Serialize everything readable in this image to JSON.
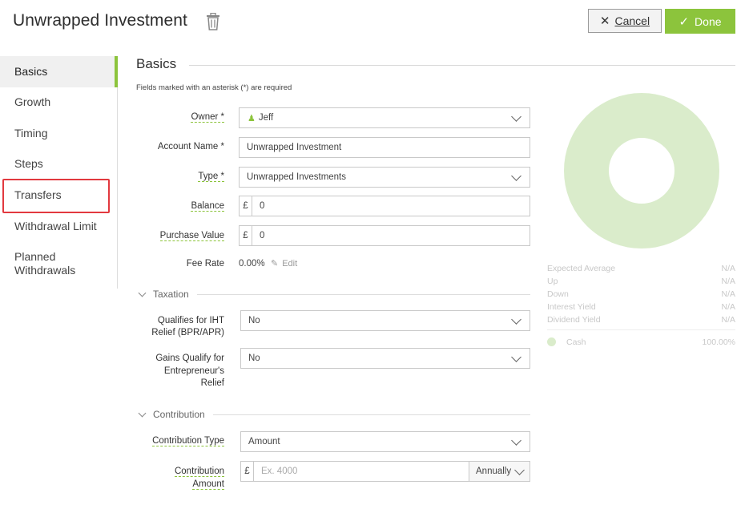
{
  "header": {
    "title": "Unwrapped Investment",
    "cancel_label": "Cancel",
    "done_label": "Done"
  },
  "sidebar": {
    "items": [
      {
        "label": "Basics"
      },
      {
        "label": "Growth"
      },
      {
        "label": "Timing"
      },
      {
        "label": "Steps"
      },
      {
        "label": "Transfers"
      },
      {
        "label": "Withdrawal Limit"
      },
      {
        "label": "Planned Withdrawals"
      }
    ]
  },
  "basics": {
    "title": "Basics",
    "required_note": "Fields marked with an asterisk (*) are required",
    "owner_label": "Owner *",
    "owner_value": "Jeff",
    "account_name_label": "Account Name *",
    "account_name_value": "Unwrapped Investment",
    "type_label": "Type *",
    "type_value": "Unwrapped Investments",
    "balance_label": "Balance",
    "balance_prefix": "£",
    "balance_value": "0",
    "purchase_label": "Purchase Value",
    "purchase_prefix": "£",
    "purchase_value": "0",
    "fee_rate_label": "Fee Rate",
    "fee_rate_value": "0.00%",
    "edit_label": "Edit"
  },
  "taxation": {
    "title": "Taxation",
    "iht_label_1": "Qualifies for IHT",
    "iht_label_2": "Relief (BPR/APR)",
    "iht_value": "No",
    "gains_label_1": "Gains Qualify for",
    "gains_label_2": "Entrepreneur's",
    "gains_label_3": "Relief",
    "gains_value": "No"
  },
  "contribution": {
    "title": "Contribution",
    "type_label": "Contribution Type",
    "type_value": "Amount",
    "amount_label_1": "Contribution",
    "amount_label_2": "Amount",
    "amount_prefix": "£",
    "amount_placeholder": "Ex. 4000",
    "frequency_value": "Annually"
  },
  "summary": {
    "stats": [
      {
        "label": "Expected Average",
        "value": "N/A"
      },
      {
        "label": "Up",
        "value": "N/A"
      },
      {
        "label": "Down",
        "value": "N/A"
      },
      {
        "label": "Interest Yield",
        "value": "N/A"
      },
      {
        "label": "Dividend Yield",
        "value": "N/A"
      }
    ],
    "legend_label": "Cash",
    "legend_value": "100.00%",
    "donut_color": "#daeccb"
  },
  "colors": {
    "accent": "#8cc43c",
    "highlight": "#e2393f"
  }
}
